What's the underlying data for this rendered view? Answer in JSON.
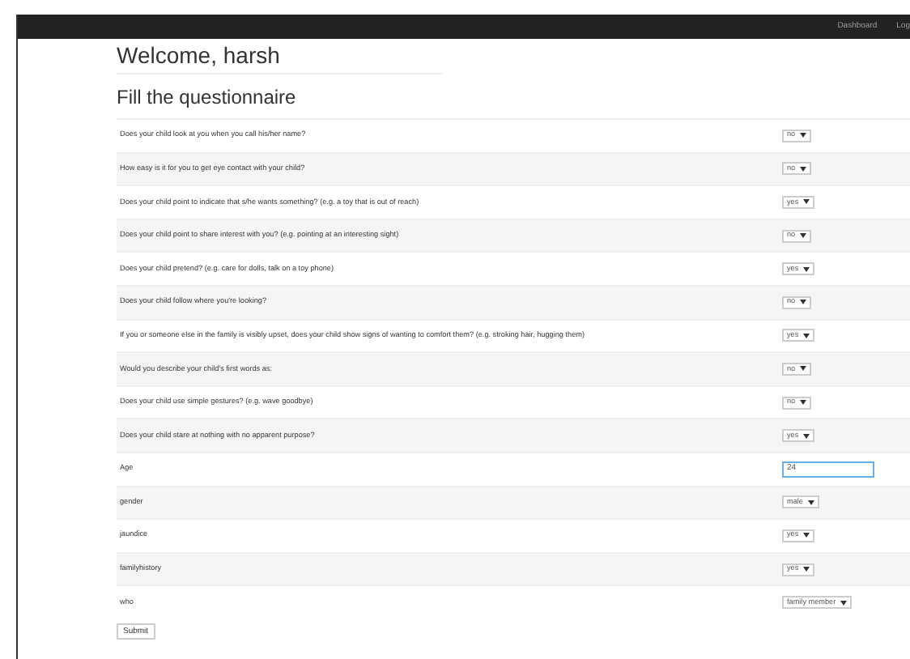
{
  "navbar": {
    "links": [
      "Dashboard",
      "Log"
    ]
  },
  "heading": "Welcome, harsh",
  "subheading": "Fill the questionnaire",
  "questions": [
    {
      "label": "Does your child look at you when you call his/her name?",
      "kind": "select",
      "value": "no"
    },
    {
      "label": "How easy is it for you to get eye contact with your child?",
      "kind": "select",
      "value": "no"
    },
    {
      "label": "Does your child point to indicate that s/he wants something? (e.g. a toy that is out of reach)",
      "kind": "select",
      "value": "yes"
    },
    {
      "label": "Does your child point to share interest with you? (e.g. pointing at an interesting sight)",
      "kind": "select",
      "value": "no"
    },
    {
      "label": "Does your child pretend? (e.g. care for dolls, talk on a toy phone)",
      "kind": "select",
      "value": "yes"
    },
    {
      "label": "Does your child follow where you're looking?",
      "kind": "select",
      "value": "no"
    },
    {
      "label": "If you or someone else in the family is visibly upset, does your child show signs of wanting to comfort them? (e.g. stroking hair, hugging them)",
      "kind": "select",
      "value": "yes"
    },
    {
      "label": "Would you describe your child's first words as:",
      "kind": "select",
      "value": "no"
    },
    {
      "label": "Does your child use simple gestures? (e.g. wave goodbye)",
      "kind": "select",
      "value": "no"
    },
    {
      "label": "Does your child stare at nothing with no apparent purpose?",
      "kind": "select",
      "value": "yes"
    },
    {
      "label": "Age",
      "kind": "input",
      "value": "24"
    },
    {
      "label": "gender",
      "kind": "select",
      "value": "male"
    },
    {
      "label": "jaundice",
      "kind": "select",
      "value": "yes"
    },
    {
      "label": "familyhistory",
      "kind": "select",
      "value": "yes"
    },
    {
      "label": "who",
      "kind": "select",
      "value": "family member"
    }
  ],
  "submit": "Submit"
}
